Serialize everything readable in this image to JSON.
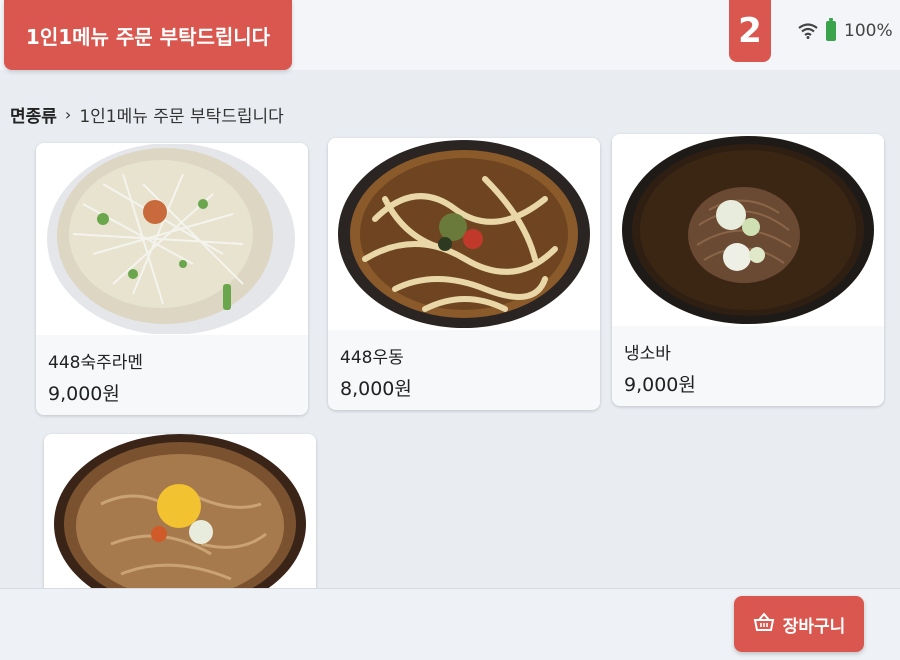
{
  "header": {
    "notice": "1인1메뉴 주문 부탁드립니다",
    "table_number": "2",
    "battery_label": "100%"
  },
  "breadcrumb": {
    "category": "면종류",
    "separator": "›",
    "subtitle": "1인1메뉴 주문 부탁드립니다"
  },
  "menu": {
    "items": [
      {
        "name": "448숙주라멘",
        "price": "9,000원",
        "icon": "ramen-bowl-image"
      },
      {
        "name": "448우동",
        "price": "8,000원",
        "icon": "udon-bowl-image"
      },
      {
        "name": "냉소바",
        "price": "9,000원",
        "icon": "cold-soba-bowl-image"
      },
      {
        "name": "",
        "price": "",
        "icon": "beef-rice-bowl-image"
      }
    ]
  },
  "cart": {
    "label": "장바구니",
    "icon": "basket-icon"
  },
  "colors": {
    "accent": "#d9574f",
    "battery": "#3aa34c",
    "background": "#e9edf2"
  }
}
